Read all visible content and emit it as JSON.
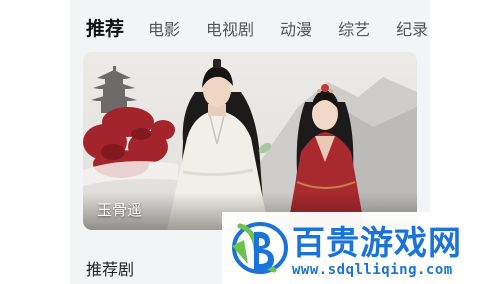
{
  "nav": {
    "tabs": [
      {
        "label": "推荐",
        "active": true
      },
      {
        "label": "电影",
        "active": false
      },
      {
        "label": "电视剧",
        "active": false
      },
      {
        "label": "动漫",
        "active": false
      },
      {
        "label": "综艺",
        "active": false
      },
      {
        "label": "纪录",
        "active": false
      }
    ]
  },
  "hero": {
    "title": "玉骨遥"
  },
  "sections": {
    "recommended_title": "推荐剧"
  },
  "watermark": {
    "name": "百贵游戏网",
    "url": "www.sdqlliqing.com"
  },
  "colors": {
    "accent_text": "#111111",
    "panel_bg": "#f3f4f6",
    "watermark_blue": "#1a73d9",
    "watermark_green": "#6cc24a"
  }
}
